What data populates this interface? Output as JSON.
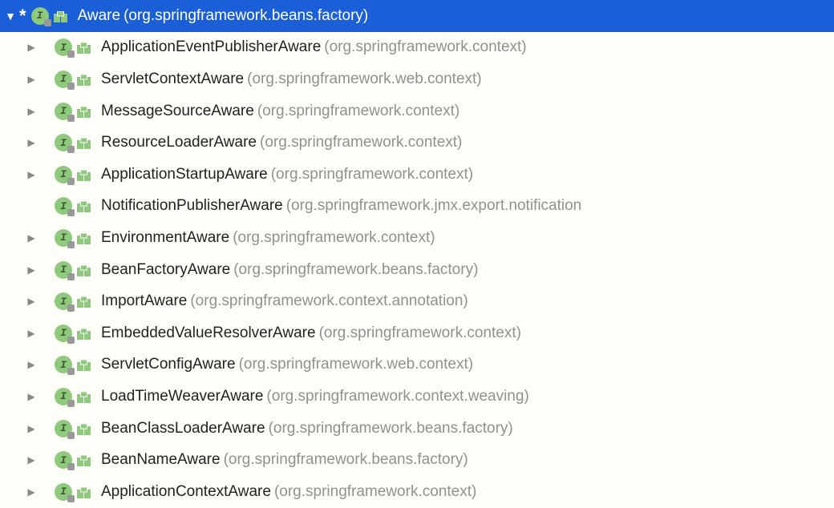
{
  "root": {
    "expanded": true,
    "name": "Aware",
    "package": "(org.springframework.beans.factory)"
  },
  "children": [
    {
      "name": "ApplicationEventPublisherAware",
      "package": "(org.springframework.context)",
      "hasChildren": true
    },
    {
      "name": "ServletContextAware",
      "package": "(org.springframework.web.context)",
      "hasChildren": true
    },
    {
      "name": "MessageSourceAware",
      "package": "(org.springframework.context)",
      "hasChildren": true
    },
    {
      "name": "ResourceLoaderAware",
      "package": "(org.springframework.context)",
      "hasChildren": true
    },
    {
      "name": "ApplicationStartupAware",
      "package": "(org.springframework.context)",
      "hasChildren": true
    },
    {
      "name": "NotificationPublisherAware",
      "package": "(org.springframework.jmx.export.notification",
      "hasChildren": false
    },
    {
      "name": "EnvironmentAware",
      "package": "(org.springframework.context)",
      "hasChildren": true
    },
    {
      "name": "BeanFactoryAware",
      "package": "(org.springframework.beans.factory)",
      "hasChildren": true
    },
    {
      "name": "ImportAware",
      "package": "(org.springframework.context.annotation)",
      "hasChildren": true
    },
    {
      "name": "EmbeddedValueResolverAware",
      "package": "(org.springframework.context)",
      "hasChildren": true
    },
    {
      "name": "ServletConfigAware",
      "package": "(org.springframework.web.context)",
      "hasChildren": true
    },
    {
      "name": "LoadTimeWeaverAware",
      "package": "(org.springframework.context.weaving)",
      "hasChildren": true
    },
    {
      "name": "BeanClassLoaderAware",
      "package": "(org.springframework.beans.factory)",
      "hasChildren": true
    },
    {
      "name": "BeanNameAware",
      "package": "(org.springframework.beans.factory)",
      "hasChildren": true
    },
    {
      "name": "ApplicationContextAware",
      "package": "(org.springframework.context)",
      "hasChildren": true
    }
  ],
  "asterisk": "*"
}
